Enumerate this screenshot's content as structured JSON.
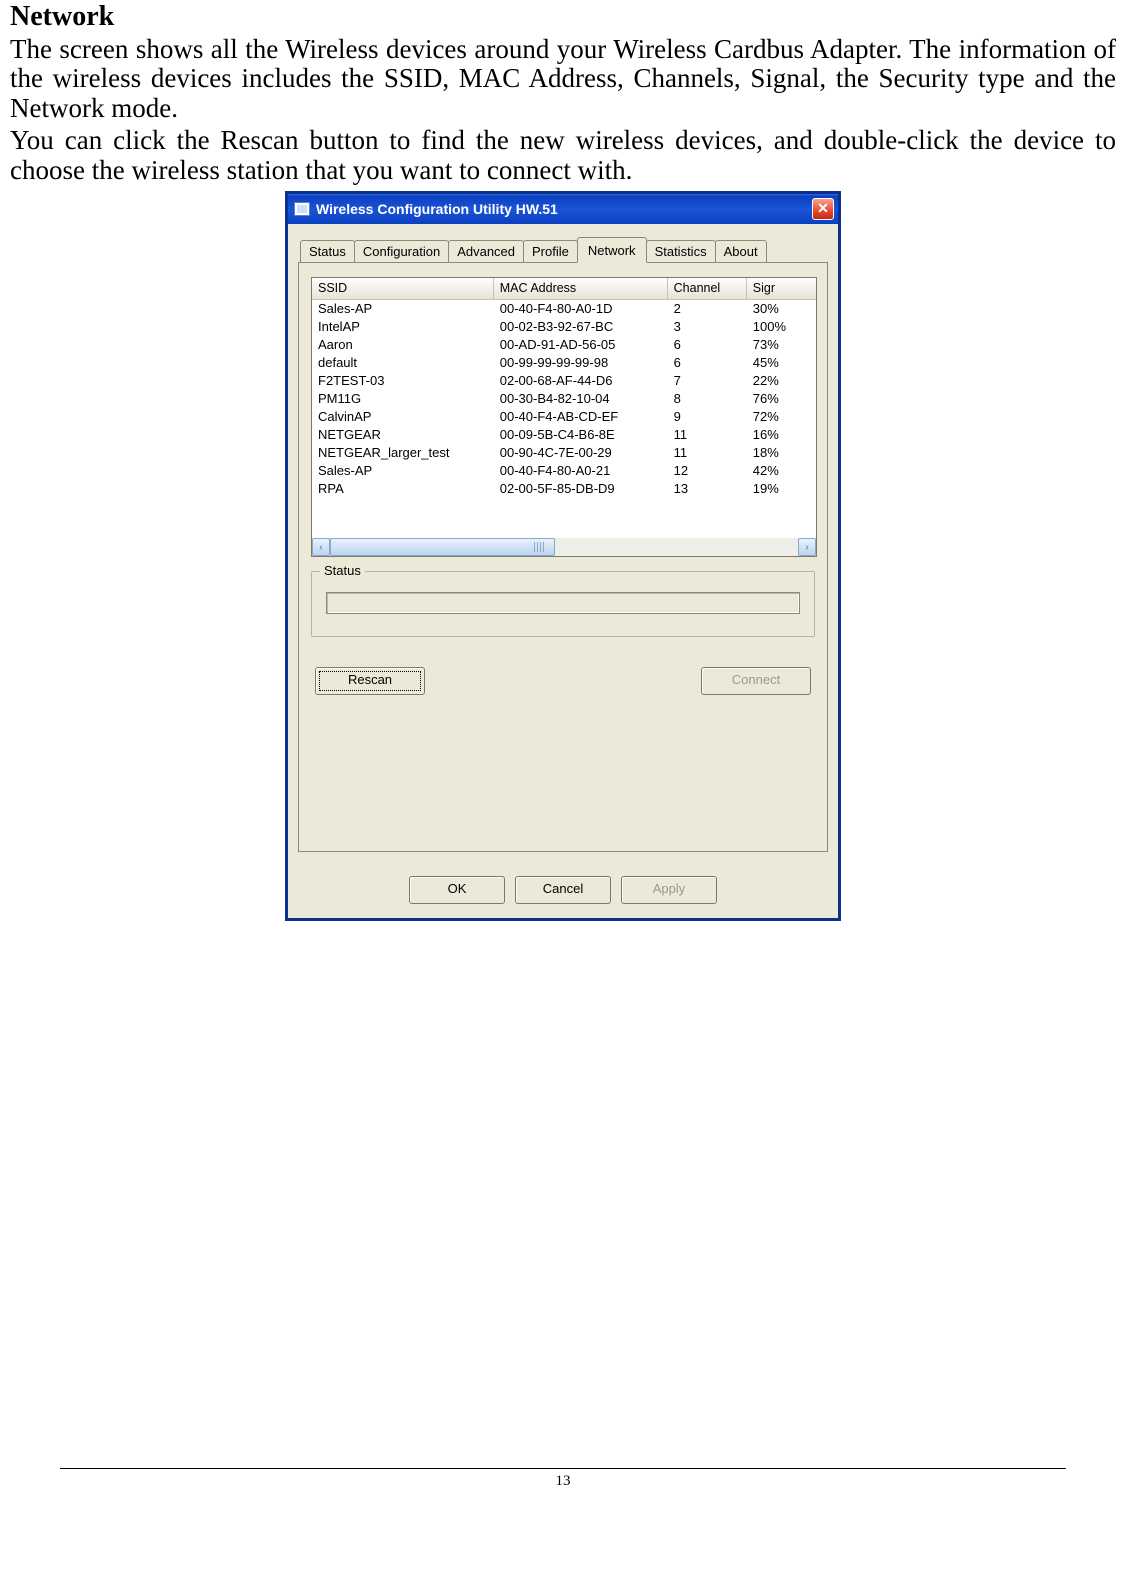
{
  "doc": {
    "heading": "Network",
    "para1": "The screen shows all the Wireless devices around your Wireless Cardbus Adapter. The information of the wireless devices includes the SSID, MAC Address, Channels, Signal, the Security type and the Network mode.",
    "para2": "You can click the Rescan button to find the new wireless devices, and double-click the device to choose the wireless station that you want to connect with.",
    "page_number": "13"
  },
  "dialog": {
    "title": "Wireless Configuration Utility HW.51",
    "close_glyph": "✕",
    "tabs": [
      "Status",
      "Configuration",
      "Advanced",
      "Profile",
      "Network",
      "Statistics",
      "About"
    ],
    "active_tab_index": 4,
    "list": {
      "columns": [
        "SSID",
        "MAC Address",
        "Channel",
        "Sigr"
      ],
      "rows": [
        {
          "ssid": "Sales-AP",
          "mac": "00-40-F4-80-A0-1D",
          "chan": "2",
          "sig": "30%"
        },
        {
          "ssid": "IntelAP",
          "mac": "00-02-B3-92-67-BC",
          "chan": "3",
          "sig": "100%"
        },
        {
          "ssid": "Aaron",
          "mac": "00-AD-91-AD-56-05",
          "chan": "6",
          "sig": "73%"
        },
        {
          "ssid": "default",
          "mac": "00-99-99-99-99-98",
          "chan": "6",
          "sig": "45%"
        },
        {
          "ssid": "F2TEST-03",
          "mac": "02-00-68-AF-44-D6",
          "chan": "7",
          "sig": "22%"
        },
        {
          "ssid": "PM11G",
          "mac": "00-30-B4-82-10-04",
          "chan": "8",
          "sig": "76%"
        },
        {
          "ssid": "CalvinAP",
          "mac": "00-40-F4-AB-CD-EF",
          "chan": "9",
          "sig": "72%"
        },
        {
          "ssid": "NETGEAR",
          "mac": "00-09-5B-C4-B6-8E",
          "chan": "11",
          "sig": "16%"
        },
        {
          "ssid": "NETGEAR_larger_test",
          "mac": "00-90-4C-7E-00-29",
          "chan": "11",
          "sig": "18%"
        },
        {
          "ssid": "Sales-AP",
          "mac": "00-40-F4-80-A0-21",
          "chan": "12",
          "sig": "42%"
        },
        {
          "ssid": "RPA",
          "mac": "02-00-5F-85-DB-D9",
          "chan": "13",
          "sig": "19%"
        }
      ]
    },
    "status_legend": "Status",
    "buttons": {
      "rescan": "Rescan",
      "connect": "Connect",
      "ok": "OK",
      "cancel": "Cancel",
      "apply": "Apply"
    },
    "scroll_glyph_left": "‹",
    "scroll_glyph_right": "›"
  }
}
